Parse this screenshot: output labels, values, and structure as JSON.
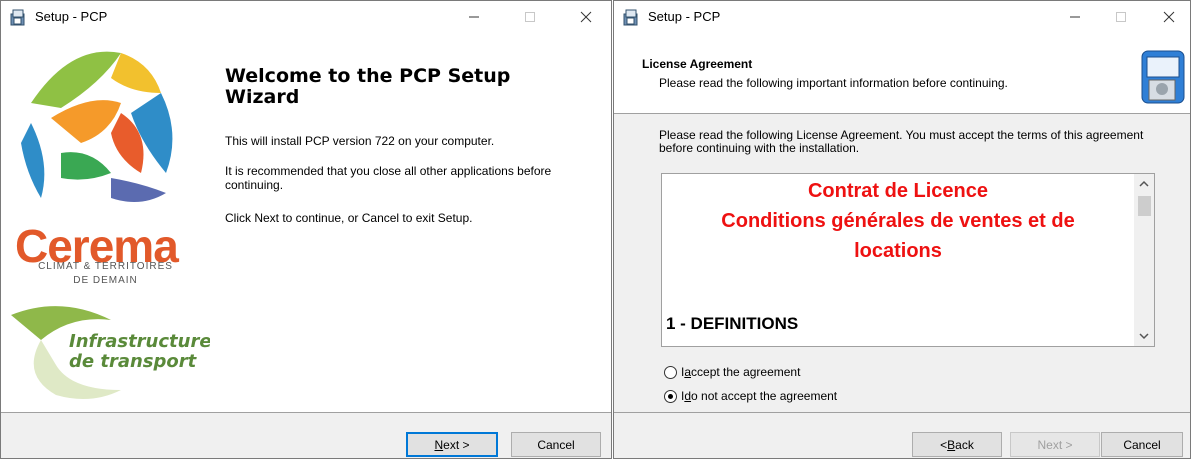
{
  "window1": {
    "title": "Setup - PCP",
    "logo": {
      "brand": "Cerema",
      "tagline1": "CLIMAT & TERRITOIRES",
      "tagline2": "DE DEMAIN",
      "program1": "Infrastructures",
      "program2": "de transport"
    },
    "heading": "Welcome to the PCP Setup Wizard",
    "paragraphs": [
      "This will install PCP version 722 on your computer.",
      "It is recommended that you close all other applications before continuing.",
      "Click Next to continue, or Cancel to exit Setup."
    ],
    "buttons": {
      "next_prefix": "",
      "next_u": "N",
      "next_rest": "ext >",
      "cancel": "Cancel"
    }
  },
  "window2": {
    "title": "Setup - PCP",
    "header_title": "License Agreement",
    "header_subtitle": "Please read the following important information before continuing.",
    "intro": "Please read the following License Agreement. You must accept the terms of this agreement before continuing with the installation.",
    "license": {
      "line1": "Contrat de Licence",
      "line2": "Conditions générales de ventes et de",
      "line3": "locations",
      "section1": "1 - DEFINITIONS"
    },
    "radios": [
      {
        "prefix": "I ",
        "u": "a",
        "rest": "ccept the agreement",
        "selected": false
      },
      {
        "prefix": "I ",
        "u": "d",
        "rest": "o not accept the agreement",
        "selected": true
      }
    ],
    "buttons": {
      "back_prefix": "< ",
      "back_u": "B",
      "back_rest": "ack",
      "next_label": "Next >",
      "cancel": "Cancel"
    }
  },
  "colors": {
    "license_red": "#ee1111",
    "cerema_orange": "#e2592a",
    "default_blue": "#0078d7"
  }
}
